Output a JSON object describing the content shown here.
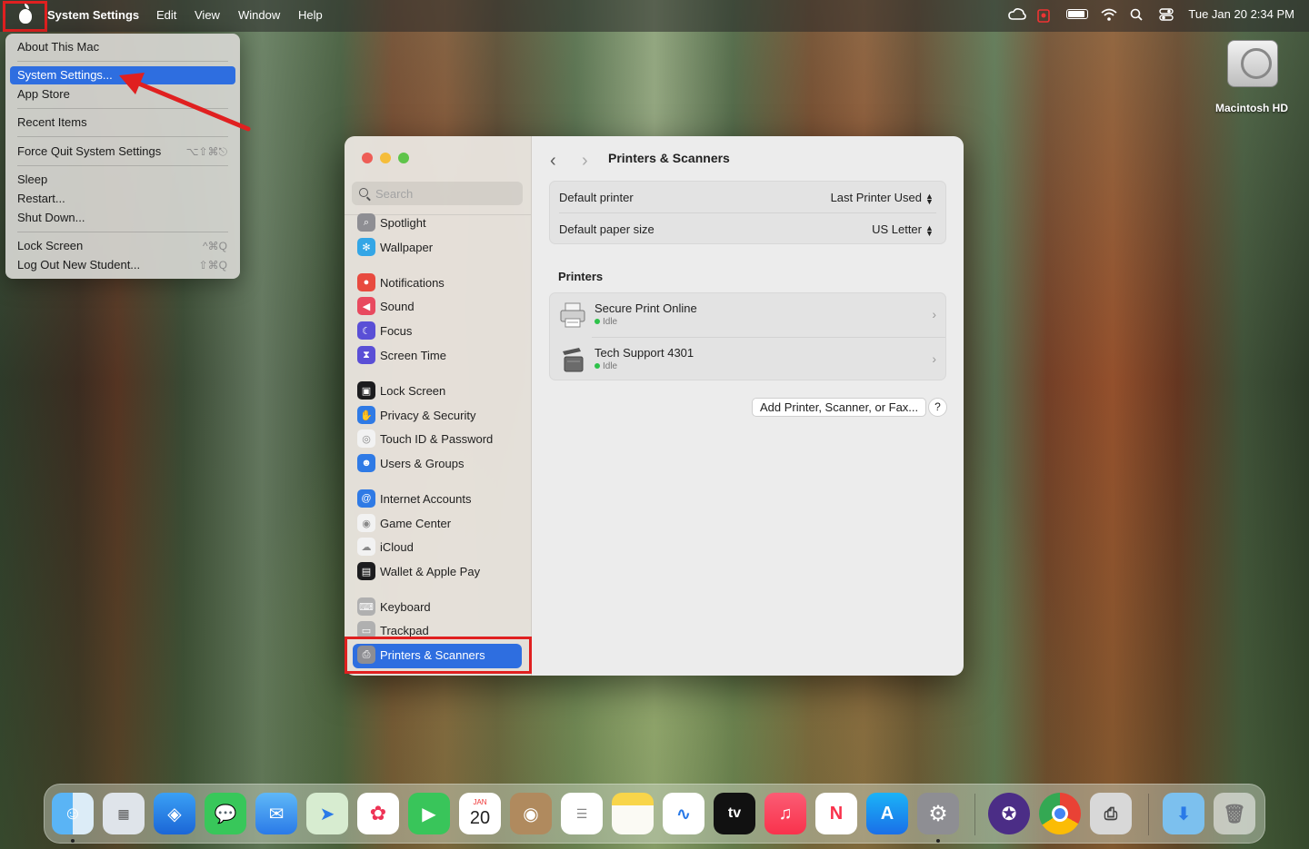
{
  "menubar": {
    "app_name": "System Settings",
    "items": [
      "Edit",
      "View",
      "Window",
      "Help"
    ],
    "datetime": "Tue Jan 20  2:34 PM"
  },
  "apple_menu": {
    "items": [
      {
        "label": "About This Mac",
        "shortcut": ""
      },
      {
        "label": "System Settings...",
        "shortcut": ""
      },
      {
        "label": "App Store",
        "shortcut": ""
      },
      {
        "label": "Recent Items",
        "shortcut": ""
      },
      {
        "label": "Force Quit System Settings",
        "shortcut": "⌥⇧⌘⎋"
      },
      {
        "label": "Sleep",
        "shortcut": ""
      },
      {
        "label": "Restart...",
        "shortcut": ""
      },
      {
        "label": "Shut Down...",
        "shortcut": ""
      },
      {
        "label": "Lock Screen",
        "shortcut": "^⌘Q"
      },
      {
        "label": "Log Out New Student...",
        "shortcut": "⇧⌘Q"
      }
    ]
  },
  "desktop": {
    "hd_label": "Macintosh HD"
  },
  "settings": {
    "search_placeholder": "Search",
    "sidebar": [
      {
        "label": "Spotlight",
        "icon": "spotlight-icon",
        "color": "#8e8e93"
      },
      {
        "label": "Wallpaper",
        "icon": "wallpaper-icon",
        "color": "#34a6e6"
      },
      {
        "label": "Notifications",
        "icon": "notifications-icon",
        "color": "#e84a3f"
      },
      {
        "label": "Sound",
        "icon": "sound-icon",
        "color": "#e84a5f"
      },
      {
        "label": "Focus",
        "icon": "focus-icon",
        "color": "#5a4fd6"
      },
      {
        "label": "Screen Time",
        "icon": "screen-time-icon",
        "color": "#5a4fd6"
      },
      {
        "label": "Lock Screen",
        "icon": "lock-screen-icon",
        "color": "#1c1c1e"
      },
      {
        "label": "Privacy & Security",
        "icon": "privacy-icon",
        "color": "#2f7ae5"
      },
      {
        "label": "Touch ID & Password",
        "icon": "touch-id-icon",
        "color": "#f2f2f2"
      },
      {
        "label": "Users & Groups",
        "icon": "users-icon",
        "color": "#2f7ae5"
      },
      {
        "label": "Internet Accounts",
        "icon": "internet-accounts-icon",
        "color": "#2f7ae5"
      },
      {
        "label": "Game Center",
        "icon": "game-center-icon",
        "color": "#f2f2f2"
      },
      {
        "label": "iCloud",
        "icon": "icloud-icon",
        "color": "#f2f2f2"
      },
      {
        "label": "Wallet & Apple Pay",
        "icon": "wallet-icon",
        "color": "#1c1c1e"
      },
      {
        "label": "Keyboard",
        "icon": "keyboard-icon",
        "color": "#b0b0b0"
      },
      {
        "label": "Trackpad",
        "icon": "trackpad-icon",
        "color": "#b0b0b0"
      },
      {
        "label": "Printers & Scanners",
        "icon": "printer-icon",
        "color": "#8e8e93"
      }
    ],
    "title": "Printers & Scanners",
    "default_printer_label": "Default printer",
    "default_printer_value": "Last Printer Used",
    "paper_size_label": "Default paper size",
    "paper_size_value": "US Letter",
    "printers_heading": "Printers",
    "printers": [
      {
        "name": "Secure Print Online",
        "status": "Idle"
      },
      {
        "name": "Tech Support 4301",
        "status": "Idle"
      }
    ],
    "add_button": "Add Printer, Scanner, or Fax...",
    "help_button": "?"
  },
  "dock": {
    "calendar_month": "JAN",
    "calendar_day": "20",
    "tv_label": "tv"
  }
}
